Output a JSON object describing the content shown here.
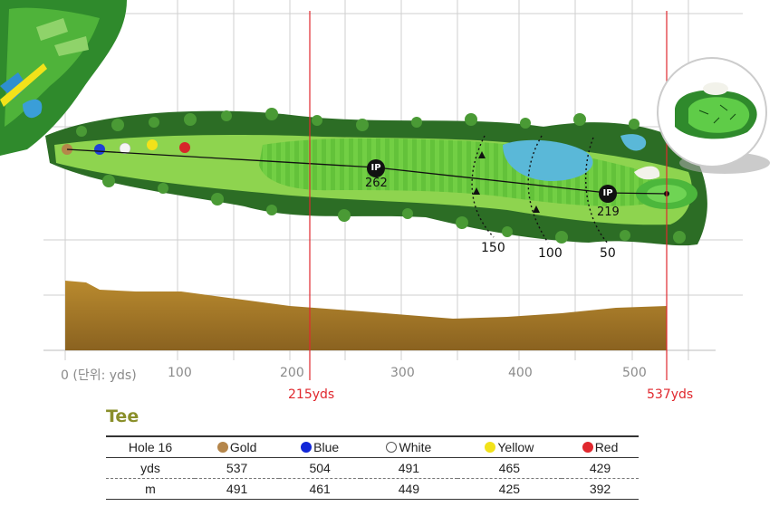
{
  "axis": {
    "tick_labels": [
      "0 (단위: yds)",
      "100",
      "200",
      "300",
      "400",
      "500"
    ],
    "markers": [
      "215yds",
      "537yds"
    ]
  },
  "hole_map": {
    "ip_points": [
      {
        "label": "IP",
        "distance": "262"
      },
      {
        "label": "IP",
        "distance": "219"
      }
    ],
    "distance_arcs": [
      "150",
      "100",
      "50"
    ],
    "tee_colors": {
      "gold": "#b5864a",
      "blue": "#1f3fd6",
      "white": "#f4f4f4",
      "yellow": "#f2e21a",
      "red": "#d7262a"
    }
  },
  "tee_section": {
    "title": "Tee",
    "table": {
      "header": [
        "Hole 16",
        "Gold",
        "Blue",
        "White",
        "Yellow",
        "Red"
      ],
      "header_colors": [
        "",
        "#b5864a",
        "#1126d8",
        "#ffffff",
        "#f2e21a",
        "#e0282e"
      ],
      "rows": [
        [
          "yds",
          "537",
          "504",
          "491",
          "465",
          "429"
        ],
        [
          "m",
          "491",
          "461",
          "449",
          "425",
          "392"
        ]
      ]
    }
  }
}
